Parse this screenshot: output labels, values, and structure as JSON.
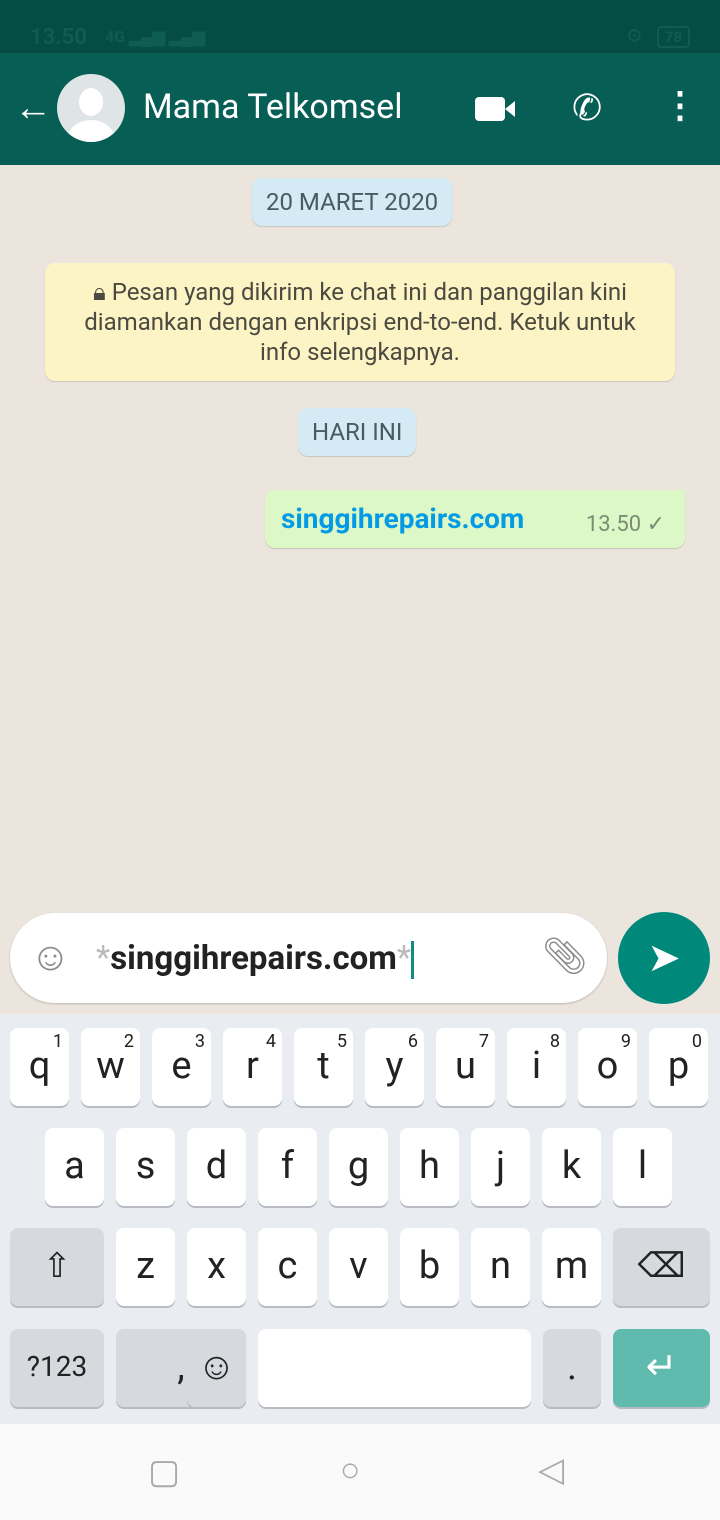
{
  "status": {
    "time": "13.50",
    "network": "4G",
    "battery": "78"
  },
  "header": {
    "contact": "Mama Telkomsel"
  },
  "chat": {
    "date_chip": "20 MARET 2020",
    "encryption_notice": "Pesan yang dikirim ke chat ini dan panggilan kini diamankan dengan enkripsi end-to-end. Ketuk untuk info selengkapnya.",
    "today_chip": "HARI INI",
    "messages": [
      {
        "text": "singgihrepairs.com",
        "time": "13.50",
        "status": "sent"
      }
    ]
  },
  "composer": {
    "value_prefix": "*",
    "value": "singgihrepairs.com",
    "value_suffix": "*"
  },
  "keyboard": {
    "row1": [
      [
        "q",
        "1"
      ],
      [
        "w",
        "2"
      ],
      [
        "e",
        "3"
      ],
      [
        "r",
        "4"
      ],
      [
        "t",
        "5"
      ],
      [
        "y",
        "6"
      ],
      [
        "u",
        "7"
      ],
      [
        "i",
        "8"
      ],
      [
        "o",
        "9"
      ],
      [
        "p",
        "0"
      ]
    ],
    "row2": [
      "a",
      "s",
      "d",
      "f",
      "g",
      "h",
      "j",
      "k",
      "l"
    ],
    "row3": [
      "z",
      "x",
      "c",
      "v",
      "b",
      "n",
      "m"
    ],
    "symbols": "?123",
    "comma": ",",
    "period": "."
  },
  "colors": {
    "header": "#075e54",
    "accent": "#00897b",
    "bubble_out": "#dcf8c6",
    "link": "#039be5"
  }
}
